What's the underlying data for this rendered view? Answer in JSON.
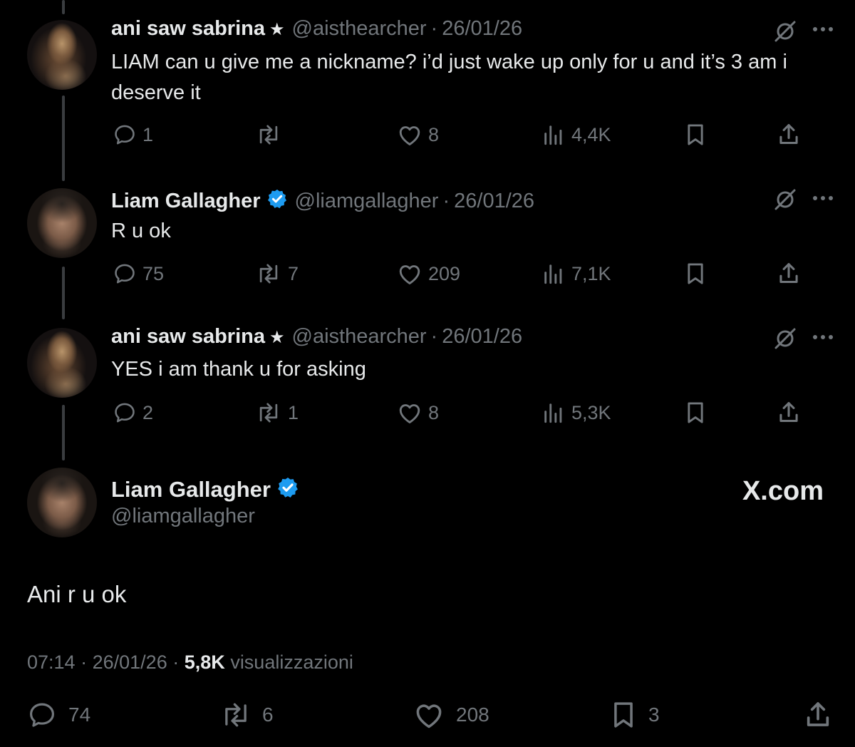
{
  "replies": [
    {
      "author": "ani saw sabrina",
      "star": "★",
      "handle": "@aisthearcher",
      "dot": "·",
      "date": "26/01/26",
      "text": "LIAM can u give me a nickname? i’d just wake up only for u and it’s 3 am i deserve it",
      "comments": "1",
      "retweets": "",
      "likes": "8",
      "views": "4,4K",
      "avatar": "avatar-ani"
    },
    {
      "author": "Liam Gallagher",
      "verified": true,
      "handle": "@liamgallagher",
      "dot": "·",
      "date": "26/01/26",
      "text": "R u ok",
      "comments": "75",
      "retweets": "7",
      "likes": "209",
      "views": "7,1K",
      "avatar": "avatar-liam"
    },
    {
      "author": "ani saw sabrina",
      "star": "★",
      "handle": "@aisthearcher",
      "dot": "·",
      "date": "26/01/26",
      "text": "YES i am thank u for asking",
      "comments": "2",
      "retweets": "1",
      "likes": "8",
      "views": "5,3K",
      "avatar": "avatar-ani"
    }
  ],
  "main": {
    "author": "Liam Gallagher",
    "handle": "@liamgallagher",
    "watermark": "X.com",
    "text": "Ani r u ok",
    "time": "07:14",
    "sep": "·",
    "date": "26/01/26",
    "views_count": "5,8K",
    "views_label": "visualizzazioni",
    "comments": "74",
    "retweets": "6",
    "likes": "208",
    "bookmarks": "3"
  },
  "colors": {
    "background": "#000000",
    "text": "#e7e9ea",
    "muted": "#71767b",
    "verified": "#1d9bf0",
    "thread_line": "#3a3d40"
  },
  "icons": [
    "comment-icon",
    "retweet-icon",
    "like-icon",
    "views-icon",
    "bookmark-icon",
    "share-icon",
    "mute-icon",
    "more-icon",
    "verified-icon"
  ]
}
